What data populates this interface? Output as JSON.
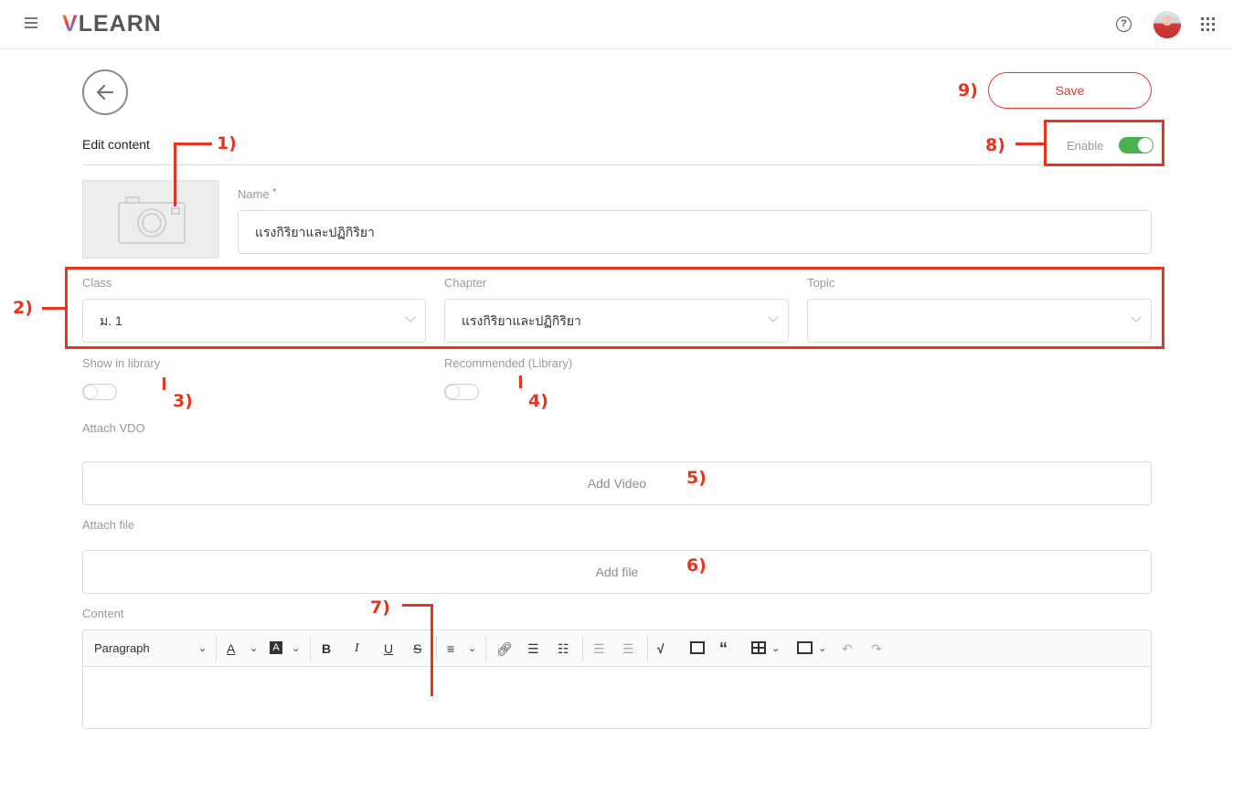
{
  "app": {
    "logo_v": "V",
    "logo_rest": "LEARN"
  },
  "header": {
    "menu_icon": "hamburger-icon",
    "help_icon": "help-circle-icon",
    "help_glyph": "?",
    "apps_icon": "grid-icon"
  },
  "page": {
    "title": "Edit content",
    "save_label": "Save",
    "enable_label": "Enable",
    "enable_on": true
  },
  "form": {
    "name_label": "Name",
    "name_required_mark": "*",
    "name_value": "แรงกิริยาและปฏิกิริยา",
    "class_label": "Class",
    "class_value": "ม. 1",
    "chapter_label": "Chapter",
    "chapter_value": "แรงกิริยาและปฏิกิริยา",
    "topic_label": "Topic",
    "topic_value": "",
    "show_in_library_label": "Show in library",
    "show_in_library_on": false,
    "recommended_label": "Recommended (Library)",
    "recommended_on": false,
    "attach_vdo_label": "Attach VDO",
    "add_video_label": "Add Video",
    "attach_file_label": "Attach file",
    "add_file_label": "Add file",
    "content_label": "Content"
  },
  "editor": {
    "paragraph_label": "Paragraph",
    "tools": [
      "font-color-icon",
      "highlight-color-icon",
      "bold-icon",
      "italic-icon",
      "underline-icon",
      "strikethrough-icon",
      "align-icon",
      "link-icon",
      "bulleted-list-icon",
      "numbered-list-icon",
      "outdent-icon",
      "indent-icon",
      "math-formula-icon",
      "image-icon",
      "blockquote-icon",
      "table-icon",
      "media-icon",
      "undo-icon",
      "redo-icon"
    ]
  },
  "annotations": {
    "a1": "1)",
    "a2": "2)",
    "a3": "3)",
    "a4": "4)",
    "a5": "5)",
    "a6": "6)",
    "a7": "7)",
    "a8": "8)",
    "a9": "9)"
  },
  "colors": {
    "accent_red": "#e53935",
    "toggle_on": "#4caf50",
    "annotation": "#e8341c"
  }
}
